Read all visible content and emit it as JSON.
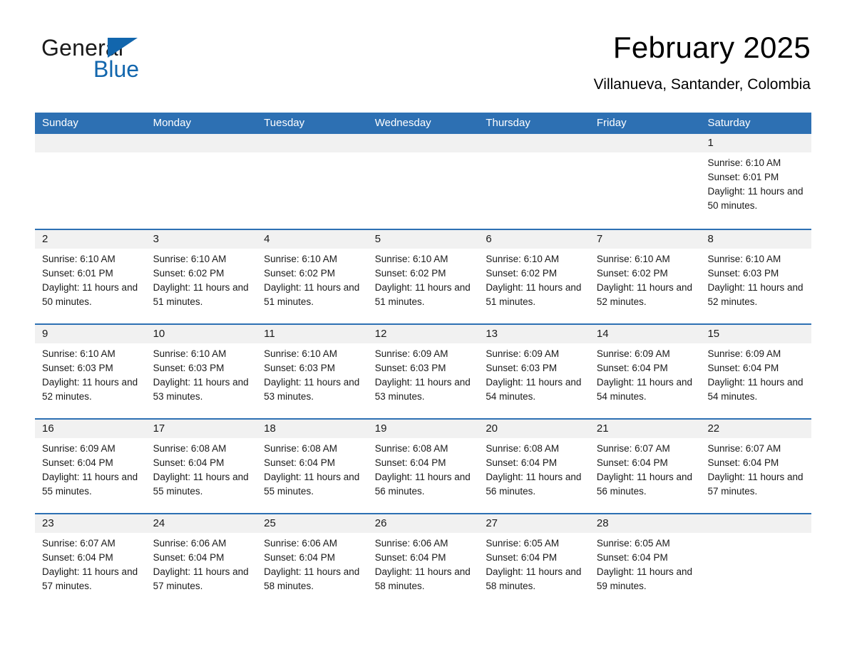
{
  "brand": {
    "name_part1": "General",
    "name_part2": "Blue",
    "triangle_icon": "triangle-icon",
    "accent_color": "#1266ad"
  },
  "header": {
    "month_title": "February 2025",
    "location": "Villanueva, Santander, Colombia"
  },
  "colors": {
    "header_blue": "#2d70b3",
    "row_band_gray": "#f1f1f1",
    "text": "#1a1a1a"
  },
  "weekdays": [
    "Sunday",
    "Monday",
    "Tuesday",
    "Wednesday",
    "Thursday",
    "Friday",
    "Saturday"
  ],
  "weeks": [
    [
      {
        "day": "",
        "sunrise": "",
        "sunset": "",
        "daylight": "",
        "empty": true
      },
      {
        "day": "",
        "sunrise": "",
        "sunset": "",
        "daylight": "",
        "empty": true
      },
      {
        "day": "",
        "sunrise": "",
        "sunset": "",
        "daylight": "",
        "empty": true
      },
      {
        "day": "",
        "sunrise": "",
        "sunset": "",
        "daylight": "",
        "empty": true
      },
      {
        "day": "",
        "sunrise": "",
        "sunset": "",
        "daylight": "",
        "empty": true
      },
      {
        "day": "",
        "sunrise": "",
        "sunset": "",
        "daylight": "",
        "empty": true
      },
      {
        "day": "1",
        "sunrise": "Sunrise: 6:10 AM",
        "sunset": "Sunset: 6:01 PM",
        "daylight": "Daylight: 11 hours and 50 minutes.",
        "empty": false
      }
    ],
    [
      {
        "day": "2",
        "sunrise": "Sunrise: 6:10 AM",
        "sunset": "Sunset: 6:01 PM",
        "daylight": "Daylight: 11 hours and 50 minutes.",
        "empty": false
      },
      {
        "day": "3",
        "sunrise": "Sunrise: 6:10 AM",
        "sunset": "Sunset: 6:02 PM",
        "daylight": "Daylight: 11 hours and 51 minutes.",
        "empty": false
      },
      {
        "day": "4",
        "sunrise": "Sunrise: 6:10 AM",
        "sunset": "Sunset: 6:02 PM",
        "daylight": "Daylight: 11 hours and 51 minutes.",
        "empty": false
      },
      {
        "day": "5",
        "sunrise": "Sunrise: 6:10 AM",
        "sunset": "Sunset: 6:02 PM",
        "daylight": "Daylight: 11 hours and 51 minutes.",
        "empty": false
      },
      {
        "day": "6",
        "sunrise": "Sunrise: 6:10 AM",
        "sunset": "Sunset: 6:02 PM",
        "daylight": "Daylight: 11 hours and 51 minutes.",
        "empty": false
      },
      {
        "day": "7",
        "sunrise": "Sunrise: 6:10 AM",
        "sunset": "Sunset: 6:02 PM",
        "daylight": "Daylight: 11 hours and 52 minutes.",
        "empty": false
      },
      {
        "day": "8",
        "sunrise": "Sunrise: 6:10 AM",
        "sunset": "Sunset: 6:03 PM",
        "daylight": "Daylight: 11 hours and 52 minutes.",
        "empty": false
      }
    ],
    [
      {
        "day": "9",
        "sunrise": "Sunrise: 6:10 AM",
        "sunset": "Sunset: 6:03 PM",
        "daylight": "Daylight: 11 hours and 52 minutes.",
        "empty": false
      },
      {
        "day": "10",
        "sunrise": "Sunrise: 6:10 AM",
        "sunset": "Sunset: 6:03 PM",
        "daylight": "Daylight: 11 hours and 53 minutes.",
        "empty": false
      },
      {
        "day": "11",
        "sunrise": "Sunrise: 6:10 AM",
        "sunset": "Sunset: 6:03 PM",
        "daylight": "Daylight: 11 hours and 53 minutes.",
        "empty": false
      },
      {
        "day": "12",
        "sunrise": "Sunrise: 6:09 AM",
        "sunset": "Sunset: 6:03 PM",
        "daylight": "Daylight: 11 hours and 53 minutes.",
        "empty": false
      },
      {
        "day": "13",
        "sunrise": "Sunrise: 6:09 AM",
        "sunset": "Sunset: 6:03 PM",
        "daylight": "Daylight: 11 hours and 54 minutes.",
        "empty": false
      },
      {
        "day": "14",
        "sunrise": "Sunrise: 6:09 AM",
        "sunset": "Sunset: 6:04 PM",
        "daylight": "Daylight: 11 hours and 54 minutes.",
        "empty": false
      },
      {
        "day": "15",
        "sunrise": "Sunrise: 6:09 AM",
        "sunset": "Sunset: 6:04 PM",
        "daylight": "Daylight: 11 hours and 54 minutes.",
        "empty": false
      }
    ],
    [
      {
        "day": "16",
        "sunrise": "Sunrise: 6:09 AM",
        "sunset": "Sunset: 6:04 PM",
        "daylight": "Daylight: 11 hours and 55 minutes.",
        "empty": false
      },
      {
        "day": "17",
        "sunrise": "Sunrise: 6:08 AM",
        "sunset": "Sunset: 6:04 PM",
        "daylight": "Daylight: 11 hours and 55 minutes.",
        "empty": false
      },
      {
        "day": "18",
        "sunrise": "Sunrise: 6:08 AM",
        "sunset": "Sunset: 6:04 PM",
        "daylight": "Daylight: 11 hours and 55 minutes.",
        "empty": false
      },
      {
        "day": "19",
        "sunrise": "Sunrise: 6:08 AM",
        "sunset": "Sunset: 6:04 PM",
        "daylight": "Daylight: 11 hours and 56 minutes.",
        "empty": false
      },
      {
        "day": "20",
        "sunrise": "Sunrise: 6:08 AM",
        "sunset": "Sunset: 6:04 PM",
        "daylight": "Daylight: 11 hours and 56 minutes.",
        "empty": false
      },
      {
        "day": "21",
        "sunrise": "Sunrise: 6:07 AM",
        "sunset": "Sunset: 6:04 PM",
        "daylight": "Daylight: 11 hours and 56 minutes.",
        "empty": false
      },
      {
        "day": "22",
        "sunrise": "Sunrise: 6:07 AM",
        "sunset": "Sunset: 6:04 PM",
        "daylight": "Daylight: 11 hours and 57 minutes.",
        "empty": false
      }
    ],
    [
      {
        "day": "23",
        "sunrise": "Sunrise: 6:07 AM",
        "sunset": "Sunset: 6:04 PM",
        "daylight": "Daylight: 11 hours and 57 minutes.",
        "empty": false
      },
      {
        "day": "24",
        "sunrise": "Sunrise: 6:06 AM",
        "sunset": "Sunset: 6:04 PM",
        "daylight": "Daylight: 11 hours and 57 minutes.",
        "empty": false
      },
      {
        "day": "25",
        "sunrise": "Sunrise: 6:06 AM",
        "sunset": "Sunset: 6:04 PM",
        "daylight": "Daylight: 11 hours and 58 minutes.",
        "empty": false
      },
      {
        "day": "26",
        "sunrise": "Sunrise: 6:06 AM",
        "sunset": "Sunset: 6:04 PM",
        "daylight": "Daylight: 11 hours and 58 minutes.",
        "empty": false
      },
      {
        "day": "27",
        "sunrise": "Sunrise: 6:05 AM",
        "sunset": "Sunset: 6:04 PM",
        "daylight": "Daylight: 11 hours and 58 minutes.",
        "empty": false
      },
      {
        "day": "28",
        "sunrise": "Sunrise: 6:05 AM",
        "sunset": "Sunset: 6:04 PM",
        "daylight": "Daylight: 11 hours and 59 minutes.",
        "empty": false
      },
      {
        "day": "",
        "sunrise": "",
        "sunset": "",
        "daylight": "",
        "empty": true
      }
    ]
  ]
}
